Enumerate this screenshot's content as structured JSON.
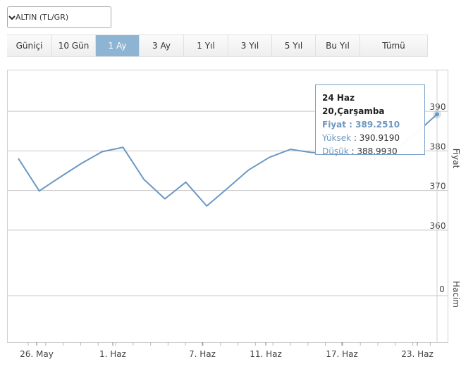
{
  "instrument_select": {
    "selected": "ALTIN (TL/GR)"
  },
  "range_tabs": [
    {
      "label": "Güniçi",
      "active": false
    },
    {
      "label": "10 Gün",
      "active": false
    },
    {
      "label": "1 Ay",
      "active": true
    },
    {
      "label": "3 Ay",
      "active": false
    },
    {
      "label": "1 Yıl",
      "active": false
    },
    {
      "label": "3 Yıl",
      "active": false
    },
    {
      "label": "5 Yıl",
      "active": false
    },
    {
      "label": "Bu Yıl",
      "active": false
    },
    {
      "label": "Tümü",
      "active": false
    }
  ],
  "tooltip": {
    "title": "24 Haz 20,Çarşamba",
    "fiyat_label": "Fiyat",
    "fiyat_value": "389.2510",
    "yuksek_label": "Yüksek",
    "yuksek_value": "390.9190",
    "dusuk_label": "Düşük",
    "dusuk_value": "388.9930"
  },
  "colors": {
    "line": "#6d98c2",
    "active_tab": "#8eb4d4",
    "grid": "#c8c8c8"
  },
  "chart_data": {
    "type": "line",
    "price_axis_label": "Fiyat",
    "volume_axis_label": "Hacim",
    "price_ticks": [
      "390",
      "380",
      "370",
      "360"
    ],
    "volume_ticks": [
      "0"
    ],
    "x_tick_labels": [
      "26. May",
      "1. Haz",
      "7. Haz",
      "11. Haz",
      "17. Haz",
      "23. Haz"
    ],
    "ylim": [
      355,
      395
    ],
    "series": [
      {
        "values": [
          378.1,
          369.9,
          373.4,
          376.8,
          379.8,
          380.9,
          372.8,
          367.9,
          372.1,
          366.1,
          370.6,
          375.2,
          378.4,
          380.4,
          379.6,
          379.3,
          380.1,
          380.1,
          380.4,
          384.5,
          389.25
        ]
      }
    ]
  }
}
